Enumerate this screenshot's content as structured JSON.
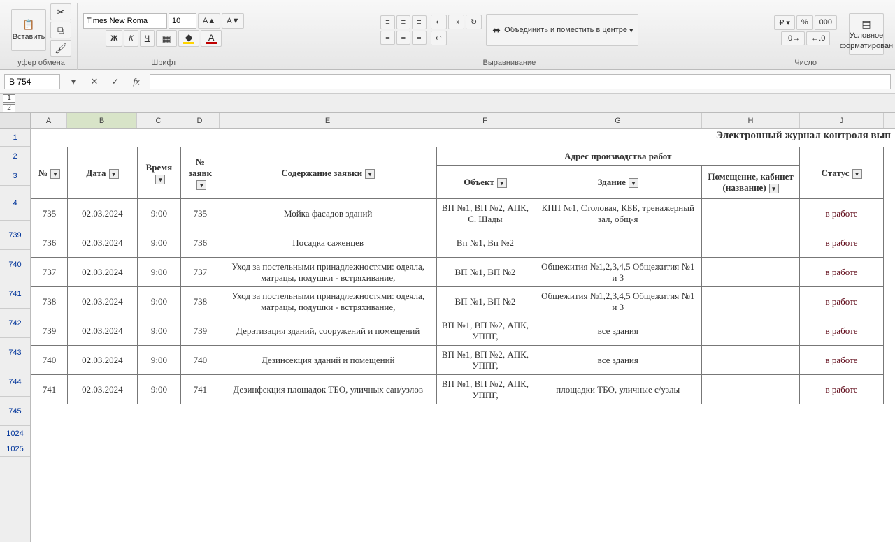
{
  "ribbon": {
    "paste_label": "Вставить",
    "clipboard_label": "уфер обмена",
    "font_name": "Times New Roma",
    "font_size": "10",
    "bold": "Ж",
    "italic": "К",
    "underline": "Ч",
    "font_group_label": "Шрифт",
    "merge_center": "Объединить и поместить в центре",
    "alignment_label": "Выравнивание",
    "number_group_label": "Число",
    "cond_format_top": "Условное",
    "cond_format_bottom": "форматирован",
    "currency_icon": "₽",
    "percent_icon": "%",
    "thousands_icon": "000"
  },
  "formula_bar": {
    "cell_ref": "B 754",
    "cancel": "✕",
    "accept": "✓",
    "fx": "fx",
    "formula": ""
  },
  "outline": {
    "level1": "1",
    "level2": "2"
  },
  "columns": [
    "A",
    "B",
    "C",
    "D",
    "E",
    "F",
    "G",
    "H",
    "J"
  ],
  "title": "Электронный журнал контроля вып",
  "headers": {
    "group_address": "Адрес производства работ",
    "num": "№",
    "date": "Дата",
    "time": "Время",
    "req_num": "№ заявк",
    "content": "Содержание заявки",
    "object": "Объект",
    "building": "Здание",
    "room": "Помещение, кабинет (название)",
    "status": "Статус"
  },
  "row_numbers_header": [
    "1",
    "2",
    "3",
    "4"
  ],
  "rows": [
    {
      "rn": "739",
      "num": "735",
      "date": "02.03.2024",
      "time": "9:00",
      "req": "735",
      "content": "Мойка фасадов зданий",
      "object": "ВП №1, ВП №2, АПК, С. Шады",
      "building": "КПП №1, Столовая, КББ, тренажерный зал, общ-я",
      "room": "",
      "status": "в работе"
    },
    {
      "rn": "740",
      "num": "736",
      "date": "02.03.2024",
      "time": "9:00",
      "req": "736",
      "content": "Посадка саженцев",
      "object": "Вп №1, Вп №2",
      "building": "",
      "room": "",
      "status": "в работе"
    },
    {
      "rn": "741",
      "num": "737",
      "date": "02.03.2024",
      "time": "9:00",
      "req": "737",
      "content": "Уход за постельными принадлежностями: одеяла, матрацы, подушки - встряхивание,",
      "object": "ВП №1, ВП №2",
      "building": "Общежития №1,2,3,4,5 Общежития №1 и 3",
      "room": "",
      "status": "в работе"
    },
    {
      "rn": "742",
      "num": "738",
      "date": "02.03.2024",
      "time": "9:00",
      "req": "738",
      "content": "Уход за постельными принадлежностями: одеяла, матрацы, подушки - встряхивание,",
      "object": "ВП №1, ВП №2",
      "building": "Общежития №1,2,3,4,5 Общежития №1 и 3",
      "room": "",
      "status": "в работе"
    },
    {
      "rn": "743",
      "num": "739",
      "date": "02.03.2024",
      "time": "9:00",
      "req": "739",
      "content": "Дератизация зданий, сооружений и помещений",
      "object": "ВП №1, ВП №2, АПК, УППГ,",
      "building": "все здания",
      "room": "",
      "status": "в работе"
    },
    {
      "rn": "744",
      "num": "740",
      "date": "02.03.2024",
      "time": "9:00",
      "req": "740",
      "content": "Дезинсекция зданий и помещений",
      "object": "ВП №1, ВП №2, АПК, УППГ,",
      "building": "все здания",
      "room": "",
      "status": "в работе"
    },
    {
      "rn": "745",
      "num": "741",
      "date": "02.03.2024",
      "time": "9:00",
      "req": "741",
      "content": "Дезинфекция площадок ТБО, уличных сан/узлов",
      "object": "ВП №1, ВП №2, АПК, УППГ,",
      "building": "площадки ТБО, уличные с/узлы",
      "room": "",
      "status": "в работе"
    }
  ],
  "blank_rows": [
    "1024",
    "1025"
  ]
}
